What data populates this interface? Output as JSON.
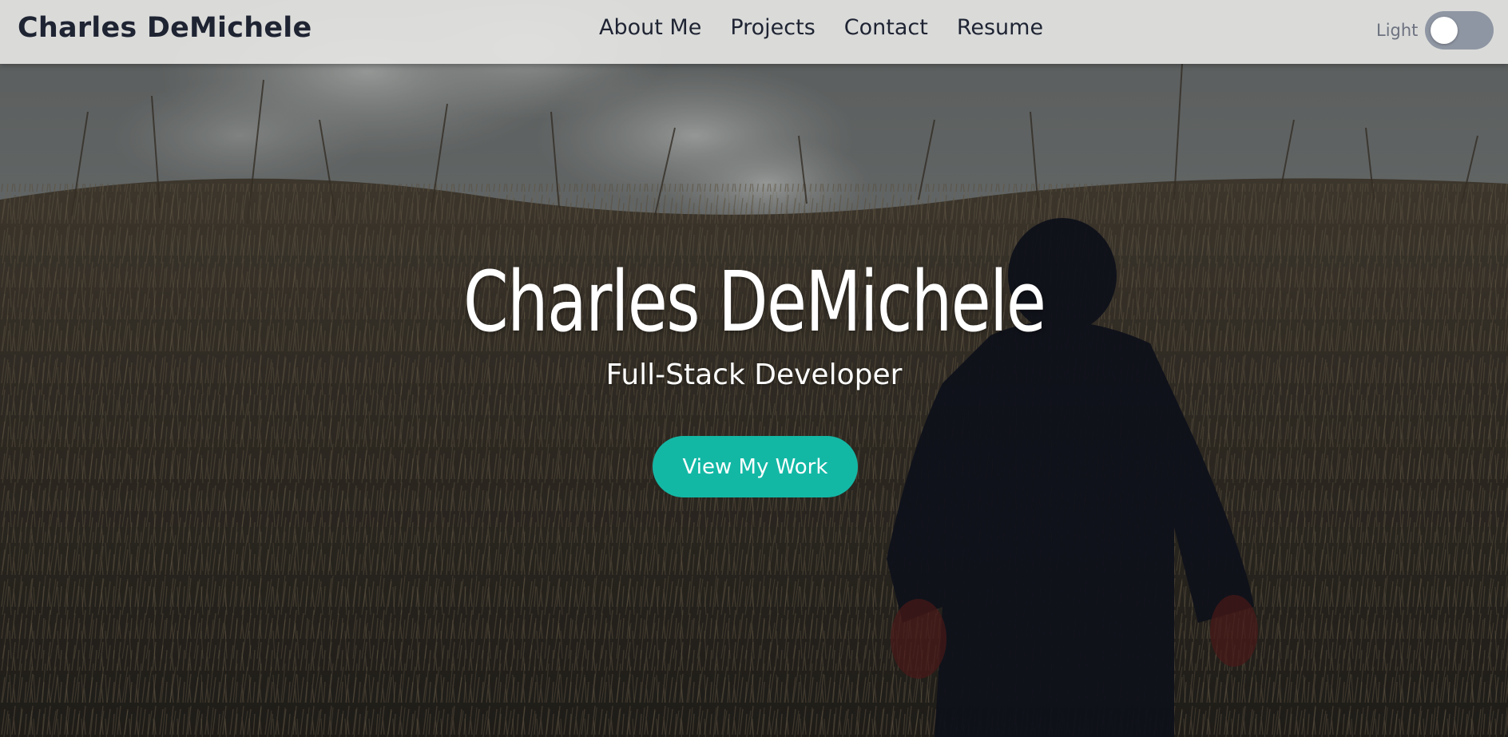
{
  "navbar": {
    "brand": "Charles DeMichele",
    "links": [
      {
        "label": "About Me"
      },
      {
        "label": "Projects"
      },
      {
        "label": "Contact"
      },
      {
        "label": "Resume"
      }
    ],
    "theme_label": "Light",
    "theme_toggle_on": false
  },
  "hero": {
    "title": "Charles DeMichele",
    "subtitle": "Full-Stack Developer",
    "cta_label": "View My Work",
    "background": "photo of a person walking through a dry grass field under a cloudy sky"
  },
  "colors": {
    "accent": "#13b8a5",
    "navbar_bg": "#e4e4e2",
    "text_dark": "#1f2433",
    "toggle_track": "#8f96a3"
  }
}
